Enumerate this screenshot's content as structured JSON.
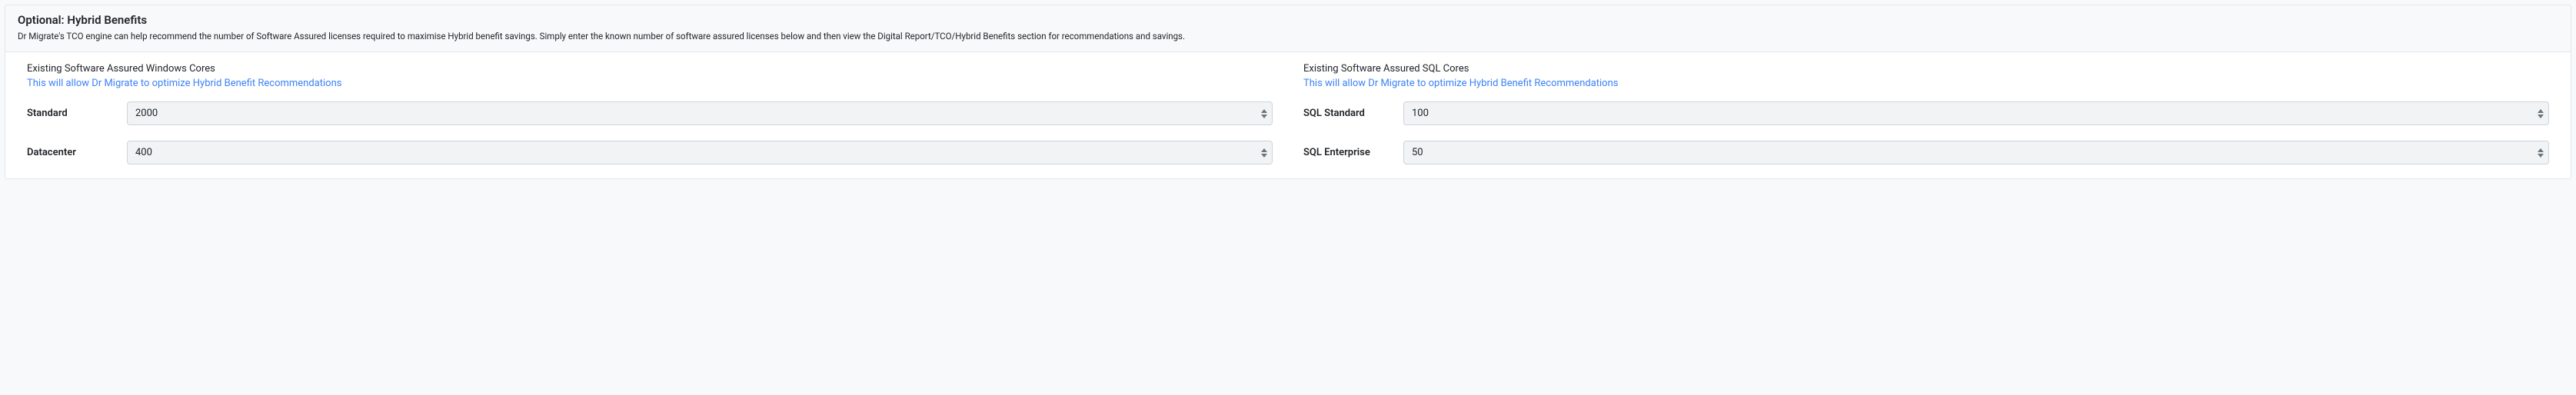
{
  "header": {
    "title": "Optional: Hybrid Benefits",
    "description": "Dr Migrate's TCO engine can help recommend the number of Software Assured licenses required to maximise Hybrid benefit savings. Simply enter the known number of software assured licenses below and then view the Digital Report/TCO/Hybrid Benefits section for recommendations and savings."
  },
  "windows": {
    "heading": "Existing Software Assured Windows Cores",
    "linkText": "This will allow Dr Migrate to optimize Hybrid Benefit Recommendations",
    "fields": {
      "standard": {
        "label": "Standard",
        "value": "2000"
      },
      "datacenter": {
        "label": "Datacenter",
        "value": "400"
      }
    }
  },
  "sql": {
    "heading": "Existing Software Assured SQL Cores",
    "linkText": "This will allow Dr Migrate to optimize Hybrid Benefit Recommendations",
    "fields": {
      "sqlStandard": {
        "label": "SQL Standard",
        "value": "100"
      },
      "sqlEnterprise": {
        "label": "SQL Enterprise",
        "value": "50"
      }
    }
  }
}
